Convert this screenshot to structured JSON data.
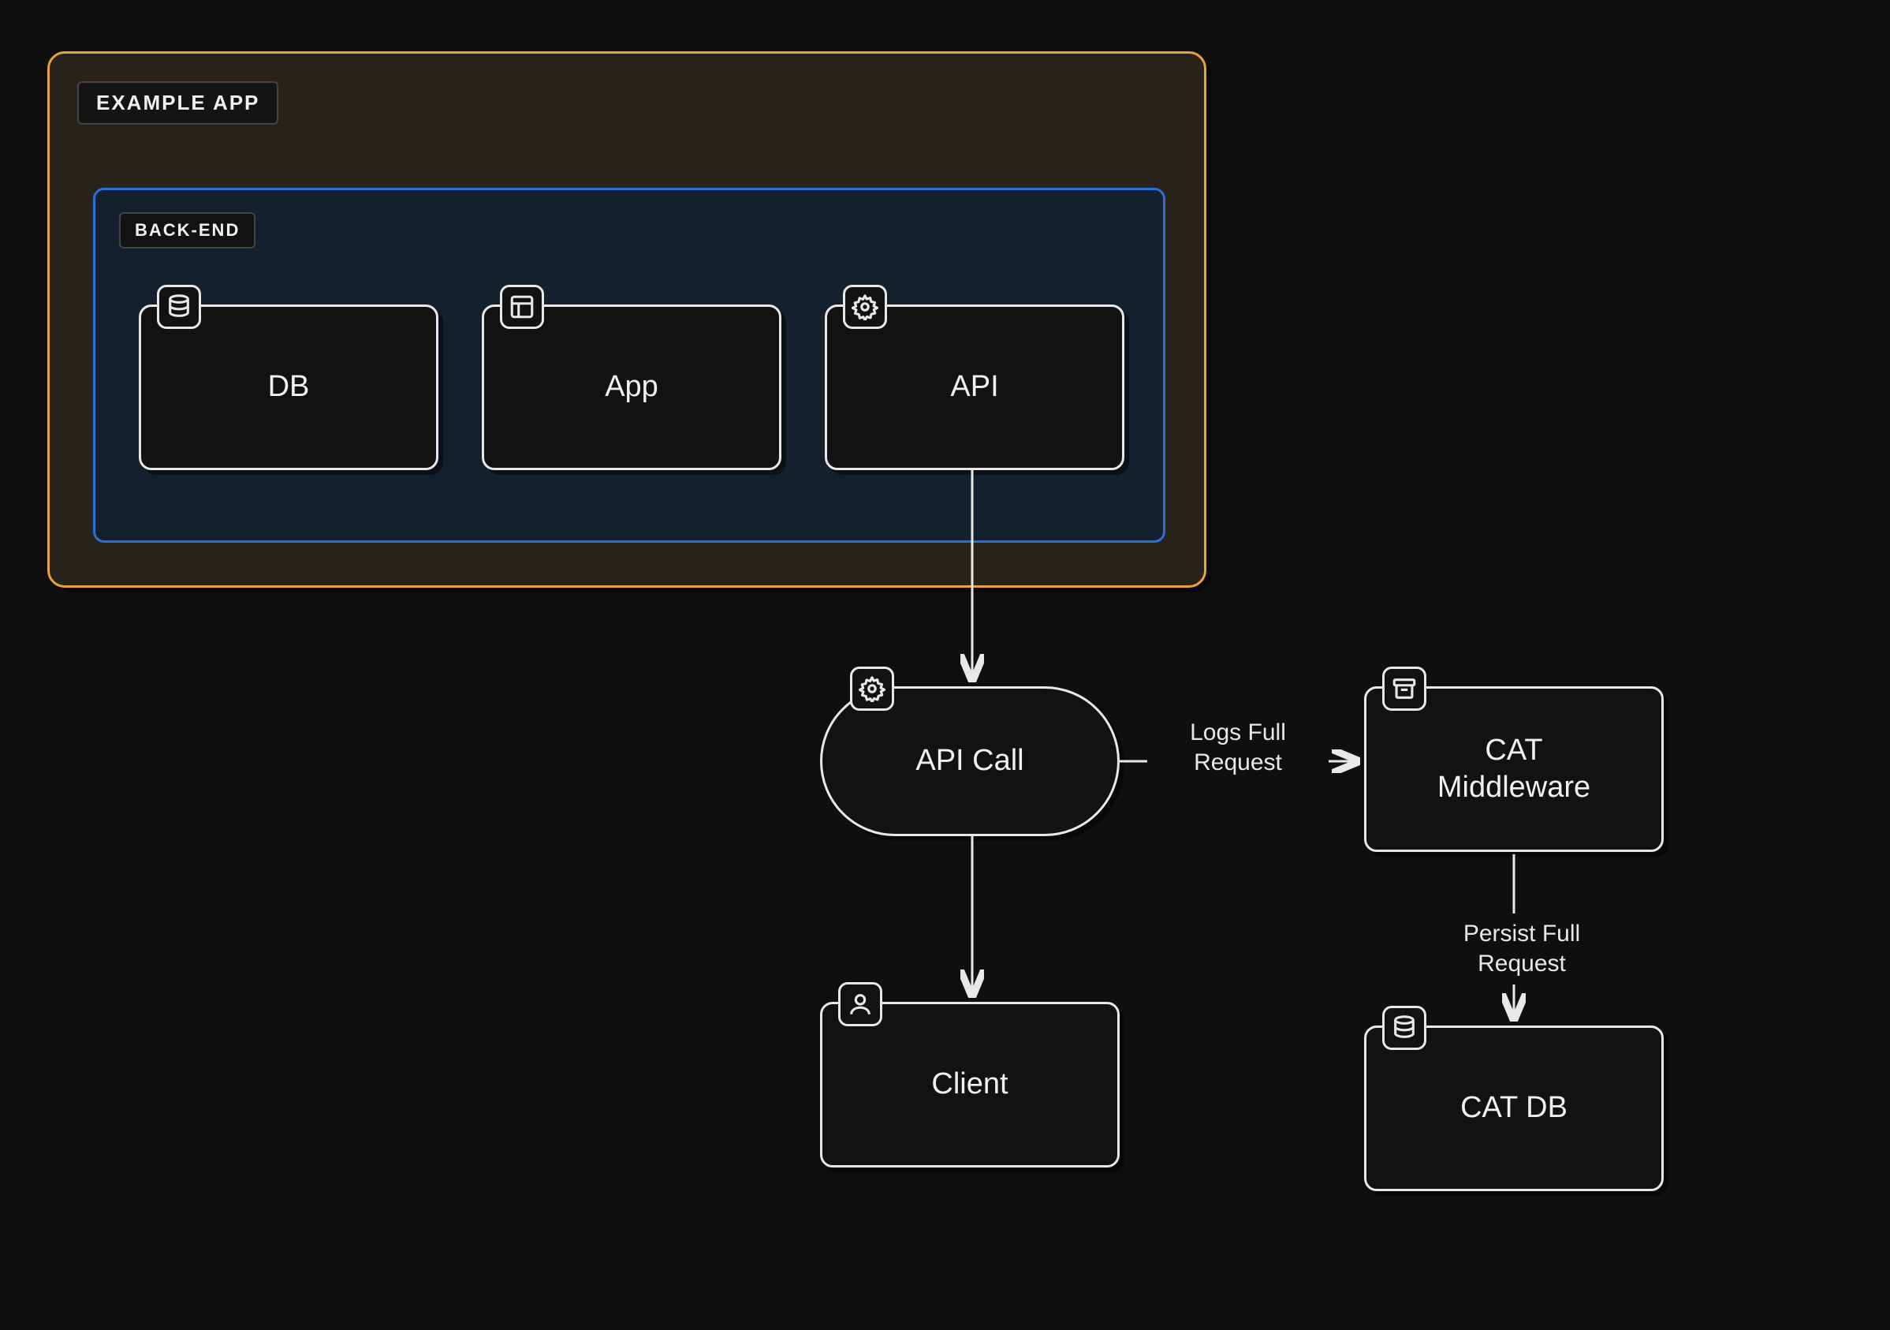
{
  "groups": {
    "outer": {
      "label": "EXAMPLE APP"
    },
    "inner": {
      "label": "BACK-END"
    }
  },
  "nodes": {
    "db": {
      "label": "DB",
      "icon": "database"
    },
    "app": {
      "label": "App",
      "icon": "layout"
    },
    "api": {
      "label": "API",
      "icon": "gear"
    },
    "apicall": {
      "label": "API Call",
      "icon": "gear"
    },
    "client": {
      "label": "Client",
      "icon": "user"
    },
    "catmw": {
      "label": "CAT\nMiddleware",
      "icon": "archive"
    },
    "catdb": {
      "label": "CAT DB",
      "icon": "database"
    }
  },
  "edges": {
    "api_to_apicall": {
      "label": ""
    },
    "apicall_to_client": {
      "label": ""
    },
    "apicall_to_catmw": {
      "label": "Logs Full\nRequest"
    },
    "catmw_to_catdb": {
      "label": "Persist Full\nRequest"
    }
  },
  "colors": {
    "outer_border": "#e8a33c",
    "outer_fill": "#28231a",
    "inner_border": "#2d6fd8",
    "inner_fill": "#14202d",
    "node_border": "#e8e8e8",
    "canvas": "#0f0f0f"
  }
}
